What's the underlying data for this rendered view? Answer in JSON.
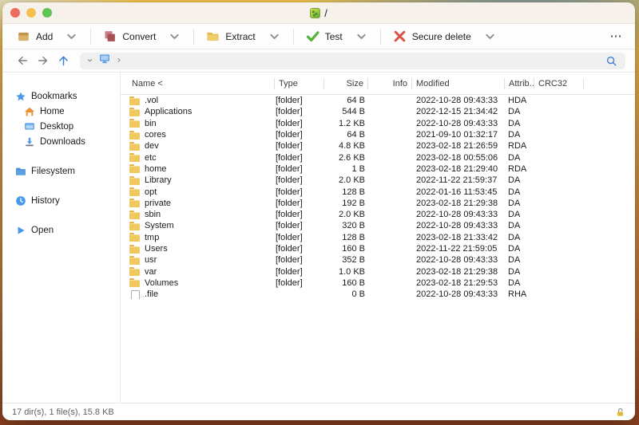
{
  "window": {
    "title": "/"
  },
  "toolbar": {
    "buttons": [
      {
        "label": "Add"
      },
      {
        "label": "Convert"
      },
      {
        "label": "Extract"
      },
      {
        "label": "Test"
      },
      {
        "label": "Secure delete"
      }
    ]
  },
  "sidebar": {
    "items": [
      {
        "label": "Bookmarks"
      },
      {
        "label": "Home"
      },
      {
        "label": "Desktop"
      },
      {
        "label": "Downloads"
      },
      {
        "label": "Filesystem"
      },
      {
        "label": "History"
      },
      {
        "label": "Open"
      }
    ]
  },
  "table": {
    "columns": [
      "Name <",
      "Type",
      "Size",
      "Info",
      "Modified",
      "Attrib...",
      "CRC32"
    ],
    "rows": [
      {
        "icon": "folder",
        "name": ".vol",
        "type": "[folder]",
        "size": "64 B",
        "modified": "2022-10-28 09:43:33",
        "attrib": "HDA"
      },
      {
        "icon": "folder",
        "name": "Applications",
        "type": "[folder]",
        "size": "544 B",
        "modified": "2022-12-15 21:34:42",
        "attrib": "DA"
      },
      {
        "icon": "folder",
        "name": "bin",
        "type": "[folder]",
        "size": "1.2 KB",
        "modified": "2022-10-28 09:43:33",
        "attrib": "DA"
      },
      {
        "icon": "folder",
        "name": "cores",
        "type": "[folder]",
        "size": "64 B",
        "modified": "2021-09-10 01:32:17",
        "attrib": "DA"
      },
      {
        "icon": "folder",
        "name": "dev",
        "type": "[folder]",
        "size": "4.8 KB",
        "modified": "2023-02-18 21:26:59",
        "attrib": "RDA"
      },
      {
        "icon": "folder",
        "name": "etc",
        "type": "[folder]",
        "size": "2.6 KB",
        "modified": "2023-02-18 00:55:06",
        "attrib": "DA"
      },
      {
        "icon": "folder",
        "name": "home",
        "type": "[folder]",
        "size": "1 B",
        "modified": "2023-02-18 21:29:40",
        "attrib": "RDA"
      },
      {
        "icon": "folder",
        "name": "Library",
        "type": "[folder]",
        "size": "2.0 KB",
        "modified": "2022-11-22 21:59:37",
        "attrib": "DA"
      },
      {
        "icon": "folder",
        "name": "opt",
        "type": "[folder]",
        "size": "128 B",
        "modified": "2022-01-16 11:53:45",
        "attrib": "DA"
      },
      {
        "icon": "folder",
        "name": "private",
        "type": "[folder]",
        "size": "192 B",
        "modified": "2023-02-18 21:29:38",
        "attrib": "DA"
      },
      {
        "icon": "folder",
        "name": "sbin",
        "type": "[folder]",
        "size": "2.0 KB",
        "modified": "2022-10-28 09:43:33",
        "attrib": "DA"
      },
      {
        "icon": "folder",
        "name": "System",
        "type": "[folder]",
        "size": "320 B",
        "modified": "2022-10-28 09:43:33",
        "attrib": "DA"
      },
      {
        "icon": "folder",
        "name": "tmp",
        "type": "[folder]",
        "size": "128 B",
        "modified": "2023-02-18 21:33:42",
        "attrib": "DA"
      },
      {
        "icon": "folder",
        "name": "Users",
        "type": "[folder]",
        "size": "160 B",
        "modified": "2022-11-22 21:59:05",
        "attrib": "DA"
      },
      {
        "icon": "folder",
        "name": "usr",
        "type": "[folder]",
        "size": "352 B",
        "modified": "2022-10-28 09:43:33",
        "attrib": "DA"
      },
      {
        "icon": "folder",
        "name": "var",
        "type": "[folder]",
        "size": "1.0 KB",
        "modified": "2023-02-18 21:29:38",
        "attrib": "DA"
      },
      {
        "icon": "folder",
        "name": "Volumes",
        "type": "[folder]",
        "size": "160 B",
        "modified": "2023-02-18 21:29:53",
        "attrib": "DA"
      },
      {
        "icon": "file",
        "name": ".file",
        "type": "",
        "size": "0 B",
        "modified": "2022-10-28 09:43:33",
        "attrib": "RHA"
      }
    ]
  },
  "statusbar": {
    "summary": "17 dir(s), 1 file(s), 15.8 KB"
  }
}
